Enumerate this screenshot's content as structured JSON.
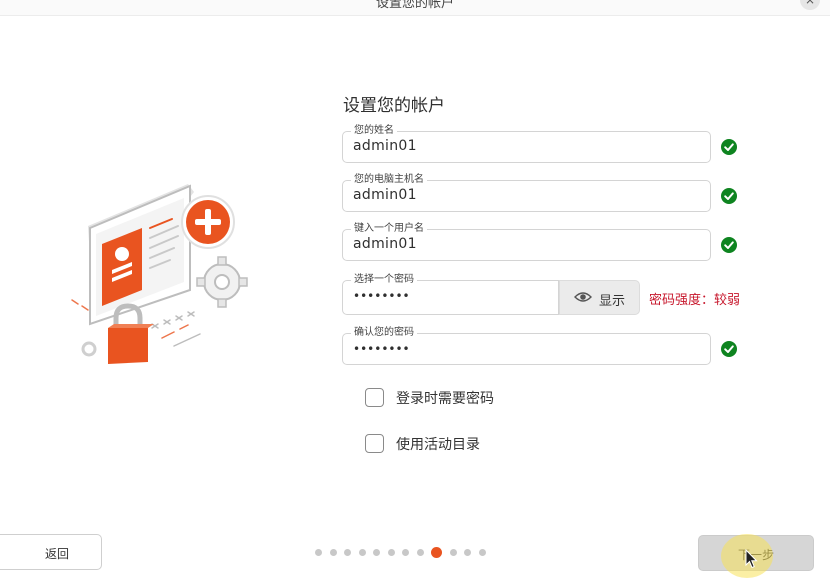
{
  "window": {
    "title": "设置您的帐户",
    "close_glyph": "×"
  },
  "form": {
    "title": "设置您的帐户",
    "fields": [
      {
        "label": "您的姓名",
        "value": "admin01",
        "valid": true
      },
      {
        "label": "您的电脑主机名",
        "value": "admin01",
        "valid": true
      },
      {
        "label": "键入一个用户名",
        "value": "admin01",
        "valid": true
      },
      {
        "label": "选择一个密码",
        "value": "••••••••"
      },
      {
        "label": "确认您的密码",
        "value": "••••••••",
        "valid": true
      }
    ],
    "show_password_label": "显示",
    "password_strength": "密码强度：较弱",
    "checkboxes": [
      {
        "label": "登录时需要密码",
        "checked": false
      },
      {
        "label": "使用活动目录",
        "checked": false
      }
    ]
  },
  "nav": {
    "back_label": "返回",
    "next_label": "下一步",
    "steps_total": 12,
    "current_step": 9
  },
  "colors": {
    "accent": "#E95420",
    "valid_green": "#0E8420",
    "error_red": "#C7162B"
  },
  "icons": {
    "valid": "check-circle-icon",
    "show_password": "eye-icon",
    "illustration": "account-setup-illustration"
  }
}
